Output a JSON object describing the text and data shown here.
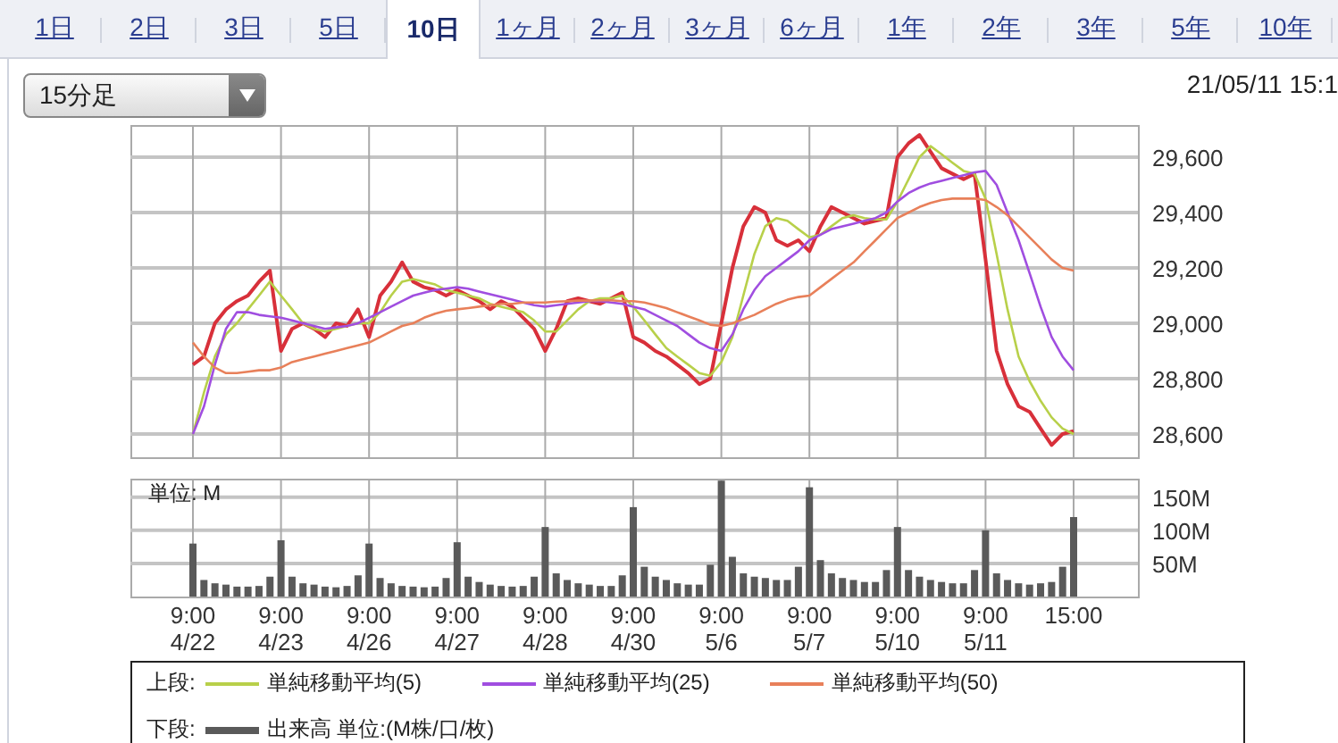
{
  "tabs": [
    {
      "label": "1日",
      "selected": false
    },
    {
      "label": "2日",
      "selected": false
    },
    {
      "label": "3日",
      "selected": false
    },
    {
      "label": "5日",
      "selected": false
    },
    {
      "label": "10日",
      "selected": true
    },
    {
      "label": "1ヶ月",
      "selected": false
    },
    {
      "label": "2ヶ月",
      "selected": false
    },
    {
      "label": "3ヶ月",
      "selected": false
    },
    {
      "label": "6ヶ月",
      "selected": false
    },
    {
      "label": "1年",
      "selected": false
    },
    {
      "label": "2年",
      "selected": false
    },
    {
      "label": "3年",
      "selected": false
    },
    {
      "label": "5年",
      "selected": false
    },
    {
      "label": "10年",
      "selected": false
    }
  ],
  "interval_select": {
    "value": "15分足"
  },
  "timestamp": "21/05/11 15:1",
  "price_chart": {
    "chart_data": {
      "type": "line",
      "grid": true,
      "categories": [
        null,
        null,
        null,
        null,
        null,
        null,
        null,
        null,
        null,
        null,
        null,
        null,
        null,
        null,
        null,
        null,
        null,
        null,
        null,
        null,
        null,
        null,
        null,
        null,
        null,
        null,
        null,
        null,
        null,
        null,
        null,
        null,
        null,
        null,
        null,
        null,
        null,
        null,
        null,
        null,
        null,
        null,
        null,
        null,
        null,
        null,
        null,
        null,
        null,
        null,
        null,
        null,
        null,
        null,
        null,
        null,
        null,
        null,
        null,
        null,
        null,
        null,
        null,
        null,
        null,
        null,
        null,
        null,
        null,
        null,
        null,
        null,
        null,
        null,
        null,
        null,
        null,
        null,
        null,
        null,
        null
      ],
      "ylim": [
        28516,
        29716
      ],
      "yticks": [
        {
          "value": 28600,
          "label": "28,600"
        },
        {
          "value": 28800,
          "label": "28,800"
        },
        {
          "value": 29000,
          "label": "29,000"
        },
        {
          "value": 29200,
          "label": "29,200"
        },
        {
          "value": 29400,
          "label": "29,400"
        },
        {
          "value": 29600,
          "label": "29,600"
        }
      ],
      "series": [
        {
          "color": "#d8303a",
          "values": [
            28850,
            28880,
            29000,
            29050,
            29080,
            29100,
            29150,
            29190,
            28900,
            28980,
            29000,
            28980,
            28950,
            29000,
            28990,
            29050,
            28950,
            29100,
            29150,
            29220,
            29150,
            29130,
            29120,
            29100,
            29120,
            29100,
            29080,
            29050,
            29080,
            29060,
            29020,
            28980,
            28900,
            28980,
            29080,
            29090,
            29080,
            29070,
            29090,
            29110,
            28950,
            28930,
            28900,
            28880,
            28850,
            28820,
            28780,
            28800,
            29000,
            29200,
            29350,
            29420,
            29400,
            29300,
            29280,
            29300,
            29260,
            29350,
            29420,
            29400,
            29380,
            29360,
            29370,
            29380,
            29600,
            29650,
            29680,
            29620,
            29560,
            29540,
            29520,
            29540,
            29230,
            28900,
            28780,
            28700,
            28680,
            28620,
            28560,
            28600,
            28610
          ]
        },
        {
          "name": "単純移動平均(5)",
          "color": "#b8d04a",
          "values": [
            28600,
            28750,
            28880,
            28960,
            29000,
            29050,
            29100,
            29150,
            29100,
            29050,
            29000,
            28980,
            28970,
            28980,
            28990,
            29000,
            29000,
            29040,
            29100,
            29150,
            29160,
            29150,
            29140,
            29120,
            29110,
            29100,
            29090,
            29070,
            29060,
            29050,
            29040,
            29010,
            28970,
            28970,
            29010,
            29050,
            29080,
            29090,
            29090,
            29100,
            29060,
            29010,
            28960,
            28910,
            28880,
            28850,
            28820,
            28810,
            28860,
            28950,
            29100,
            29250,
            29350,
            29380,
            29370,
            29340,
            29310,
            29320,
            29350,
            29380,
            29390,
            29380,
            29375,
            29375,
            29440,
            29520,
            29600,
            29640,
            29610,
            29580,
            29550,
            29540,
            29450,
            29250,
            29050,
            28880,
            28790,
            28720,
            28660,
            28620,
            28600
          ]
        },
        {
          "name": "単純移動平均(25)",
          "color": "#a04ee0",
          "values": [
            28600,
            28700,
            28850,
            28980,
            29040,
            29040,
            29030,
            29025,
            29020,
            29010,
            29000,
            28990,
            28980,
            28985,
            28990,
            29000,
            29020,
            29040,
            29060,
            29080,
            29100,
            29110,
            29120,
            29125,
            29130,
            29125,
            29115,
            29105,
            29095,
            29085,
            29075,
            29065,
            29060,
            29065,
            29070,
            29075,
            29080,
            29080,
            29075,
            29070,
            29060,
            29050,
            29030,
            29010,
            28990,
            28960,
            28930,
            28910,
            28900,
            28960,
            29050,
            29120,
            29170,
            29200,
            29230,
            29260,
            29300,
            29320,
            29340,
            29350,
            29360,
            29370,
            29380,
            29400,
            29440,
            29470,
            29490,
            29505,
            29515,
            29525,
            29535,
            29545,
            29550,
            29500,
            29400,
            29300,
            29180,
            29060,
            28950,
            28880,
            28830
          ]
        },
        {
          "name": "単純移動平均(50)",
          "color": "#e8805a",
          "values": [
            28930,
            28880,
            28840,
            28820,
            28820,
            28825,
            28830,
            28830,
            28840,
            28860,
            28870,
            28880,
            28890,
            28900,
            28910,
            28920,
            28930,
            28950,
            28970,
            28990,
            29000,
            29020,
            29035,
            29045,
            29050,
            29055,
            29060,
            29065,
            29070,
            29070,
            29075,
            29075,
            29075,
            29078,
            29080,
            29082,
            29082,
            29083,
            29083,
            29080,
            29080,
            29075,
            29065,
            29055,
            29040,
            29025,
            29010,
            28995,
            28990,
            29000,
            29015,
            29030,
            29050,
            29070,
            29085,
            29095,
            29100,
            29130,
            29160,
            29190,
            29220,
            29260,
            29300,
            29340,
            29380,
            29400,
            29420,
            29435,
            29445,
            29450,
            29450,
            29450,
            29445,
            29420,
            29390,
            29350,
            29310,
            29270,
            29230,
            29200,
            29190
          ]
        }
      ]
    }
  },
  "volume_chart": {
    "unit_label": "単位: M",
    "chart_data": {
      "type": "bar",
      "grid": true,
      "categories": [
        "9:00 4/22",
        null,
        null,
        null,
        null,
        null,
        null,
        null,
        "9:00 4/23",
        null,
        null,
        null,
        null,
        null,
        null,
        null,
        "9:00 4/26",
        null,
        null,
        null,
        null,
        null,
        null,
        null,
        "9:00 4/27",
        null,
        null,
        null,
        null,
        null,
        null,
        null,
        "9:00 4/28",
        null,
        null,
        null,
        null,
        null,
        null,
        null,
        "9:00 4/30",
        null,
        null,
        null,
        null,
        null,
        null,
        null,
        "9:00 5/6",
        null,
        null,
        null,
        null,
        null,
        null,
        null,
        "9:00 5/7",
        null,
        null,
        null,
        null,
        null,
        null,
        null,
        "9:00 5/10",
        null,
        null,
        null,
        null,
        null,
        null,
        null,
        "9:00 5/11",
        null,
        null,
        null,
        null,
        null,
        null,
        null,
        "15:00"
      ],
      "ylim": [
        0,
        178
      ],
      "yticks": [
        {
          "value": 50,
          "label": "50M"
        },
        {
          "value": 100,
          "label": "100M"
        },
        {
          "value": 150,
          "label": "150M"
        }
      ],
      "series": [
        {
          "color": "#5a5a5a",
          "values": [
            80,
            25,
            20,
            18,
            15,
            15,
            16,
            30,
            85,
            30,
            20,
            18,
            15,
            14,
            16,
            32,
            80,
            28,
            20,
            16,
            15,
            14,
            15,
            28,
            82,
            30,
            22,
            18,
            16,
            15,
            16,
            30,
            105,
            35,
            25,
            20,
            18,
            16,
            16,
            32,
            135,
            45,
            30,
            25,
            20,
            18,
            18,
            48,
            175,
            60,
            35,
            30,
            28,
            25,
            25,
            45,
            165,
            55,
            35,
            28,
            25,
            22,
            22,
            40,
            105,
            40,
            30,
            25,
            22,
            20,
            20,
            40,
            100,
            35,
            25,
            20,
            18,
            20,
            22,
            45,
            120
          ]
        }
      ]
    }
  },
  "legend": {
    "upper_label": "上段:",
    "lower_label": "下段:",
    "lower_item": {
      "label": "出来高 単位:(M株/口/枚)",
      "color": "#5a5a5a"
    }
  }
}
